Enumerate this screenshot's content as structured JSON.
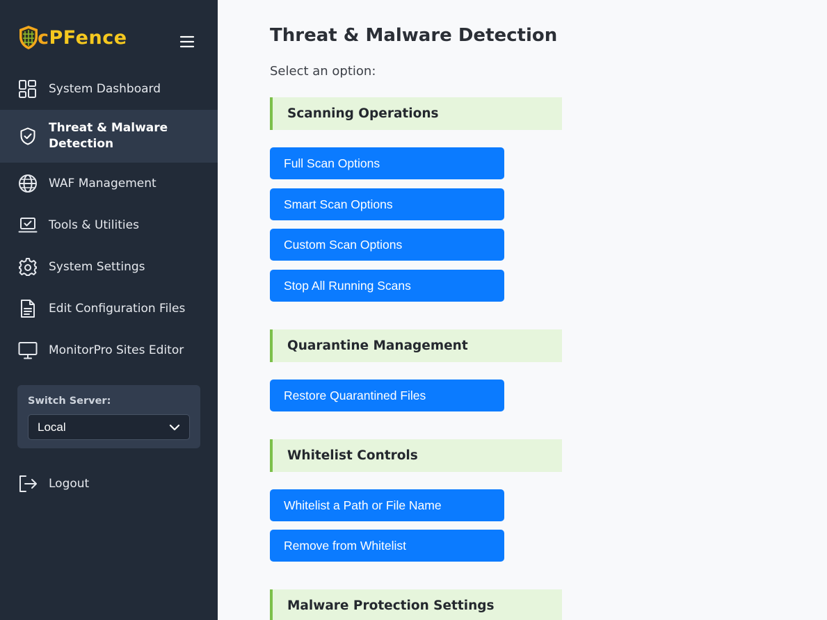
{
  "brand": {
    "name_first": "c",
    "name_rest": "PFence"
  },
  "sidebar": {
    "items": [
      {
        "label": "System Dashboard",
        "icon": "dashboard-grid-icon"
      },
      {
        "label": "Threat & Malware Detection",
        "icon": "shield-check-icon",
        "active": true
      },
      {
        "label": "WAF Management",
        "icon": "globe-icon"
      },
      {
        "label": "Tools & Utilities",
        "icon": "laptop-check-icon"
      },
      {
        "label": "System Settings",
        "icon": "gear-icon"
      },
      {
        "label": "Edit Configuration Files",
        "icon": "file-text-icon"
      },
      {
        "label": "MonitorPro Sites Editor",
        "icon": "monitor-icon"
      }
    ],
    "switch_server": {
      "label": "Switch Server:",
      "selected": "Local"
    },
    "logout": {
      "label": "Logout",
      "icon": "logout-icon"
    }
  },
  "main": {
    "title": "Threat & Malware Detection",
    "subtitle": "Select an option:",
    "sections": [
      {
        "title": "Scanning Operations",
        "buttons": [
          "Full Scan Options",
          "Smart Scan Options",
          "Custom Scan Options",
          "Stop All Running Scans"
        ]
      },
      {
        "title": "Quarantine Management",
        "buttons": [
          "Restore Quarantined Files"
        ]
      },
      {
        "title": "Whitelist Controls",
        "buttons": [
          "Whitelist a Path or File Name",
          "Remove from Whitelist"
        ]
      },
      {
        "title": "Malware Protection Settings",
        "buttons": []
      }
    ]
  },
  "colors": {
    "sidebar_bg": "#222b38",
    "accent_blue": "#0b7bff",
    "section_bg": "#e6f5dc",
    "section_border": "#7cc04a",
    "brand_yellow": "#f5c81f"
  }
}
